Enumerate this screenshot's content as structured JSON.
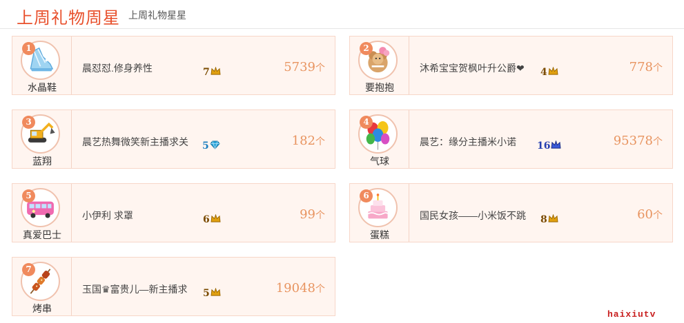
{
  "header": {
    "title": "上周礼物周星",
    "subtitle": "上周礼物星星"
  },
  "colors": {
    "accent": "#e8502c",
    "count": "#e89460",
    "rank_badge": "#f08a5d",
    "card_bg": "#fff5f0",
    "crown_gold": "#e0a010",
    "diamond_blue": "#2aa4d8",
    "level_blue": "#2640b0"
  },
  "cards": [
    {
      "rank": "1",
      "gift": "水晶鞋",
      "gift_icon": "crystal-shoe-icon",
      "user": "晨怼怼.修身养性",
      "level": "7",
      "level_icon": "crown-icon",
      "count": "5739",
      "unit": "个"
    },
    {
      "rank": "2",
      "gift": "要抱抱",
      "gift_icon": "hug-bear-icon",
      "user": "沐希宝宝贺枫叶升公爵❤",
      "level": "4",
      "level_icon": "crown-icon",
      "count": "778",
      "unit": "个"
    },
    {
      "rank": "3",
      "gift": "蓝翔",
      "gift_icon": "excavator-icon",
      "user": "晨艺热舞微笑新主播求关",
      "level": "5",
      "level_icon": "diamond-icon",
      "count": "182",
      "unit": "个"
    },
    {
      "rank": "4",
      "gift": "气球",
      "gift_icon": "balloons-icon",
      "user": "晨艺：缘分主播米小诺",
      "level": "16",
      "level_icon": "crown-blue-icon",
      "count": "95378",
      "unit": "个"
    },
    {
      "rank": "5",
      "gift": "真爱巴士",
      "gift_icon": "love-bus-icon",
      "user": "小伊利 求罩",
      "level": "6",
      "level_icon": "crown-icon",
      "count": "99",
      "unit": "个"
    },
    {
      "rank": "6",
      "gift": "蛋糕",
      "gift_icon": "cake-icon",
      "user": "国民女孩——小米饭不跳",
      "level": "8",
      "level_icon": "crown-icon",
      "count": "60",
      "unit": "个"
    },
    {
      "rank": "7",
      "gift": "烤串",
      "gift_icon": "kebab-icon",
      "user": "玉国♛富贵儿—新主播求",
      "level": "5",
      "level_icon": "crown-icon",
      "count": "19048",
      "unit": "个"
    }
  ],
  "watermark": "haixiutv"
}
